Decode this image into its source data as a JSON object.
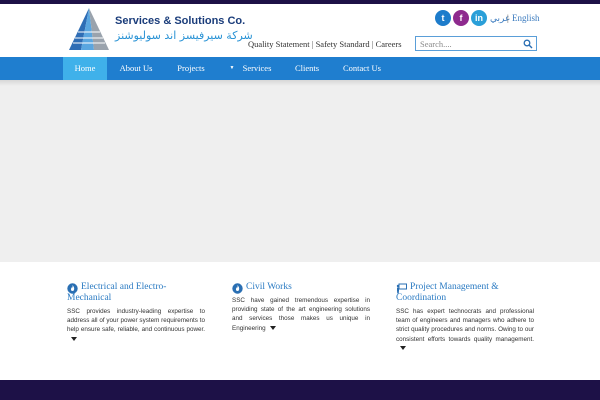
{
  "header": {
    "company_en": "Services & Solutions Co.",
    "company_ar": "شركة سيرفيسز اند سوليوشنز",
    "social": {
      "twitter_glyph": "t",
      "facebook_glyph": "f",
      "linkedin_glyph": "in"
    },
    "lang_ar": "عربي",
    "lang_sep": "|",
    "lang_en": "English",
    "top_links": [
      "Quality Statement",
      "Safety Standard",
      "Careers"
    ],
    "top_link_sep": "|",
    "search_placeholder": "Search...."
  },
  "nav": {
    "items": [
      {
        "label": "Home"
      },
      {
        "label": "About Us"
      },
      {
        "label": "Projects"
      },
      {
        "label": "Services"
      },
      {
        "label": "Clients"
      },
      {
        "label": "Contact Us"
      }
    ],
    "services_arrow": "▼"
  },
  "features": [
    {
      "title": "Electrical and Electro-Mechanical",
      "text": "SSC provides industry-leading expertise to address all of your power system requirements to help ensure safe, reliable, and continuous power."
    },
    {
      "title": "Civil Works",
      "text": "SSC have gained tremendous expertise in providing state of the art engineering solutions and services those makes us unique in Engineering"
    },
    {
      "title": "Project Management & Coordination",
      "text": "SSC has expert technocrats and professional team of engineers and managers who adhere to strict quality procedures and norms. Owing to our consistent efforts towards quality management."
    }
  ],
  "colors": {
    "nav": "#1f7ecf",
    "nav_active": "#3fb1ea",
    "footer": "#1d1147",
    "title_blue": "#2a7ac2"
  },
  "icons": {
    "social": [
      "twitter-icon",
      "facebook-icon",
      "linkedin-icon"
    ],
    "search": "search-icon",
    "features": [
      "flame-icon",
      "flame-icon",
      "presentation-icon"
    ]
  }
}
